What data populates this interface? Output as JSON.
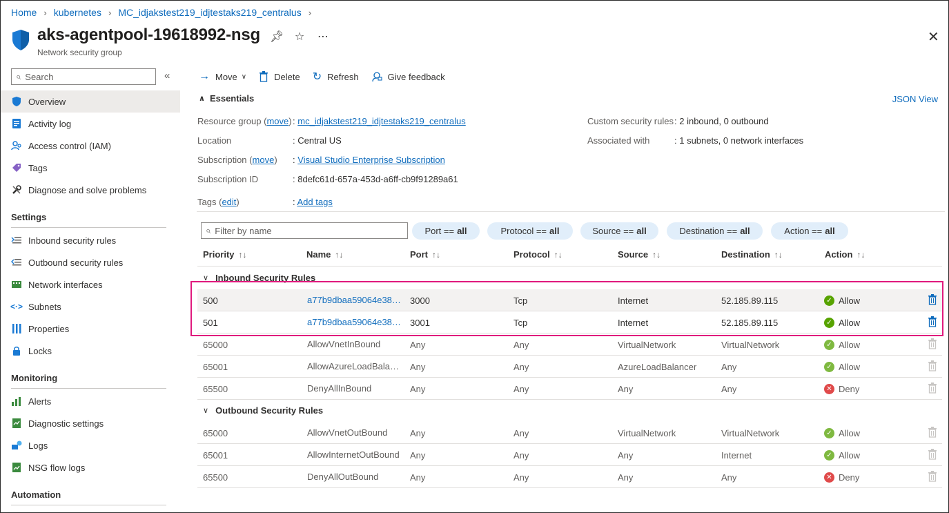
{
  "breadcrumb": [
    "Home",
    "kubernetes",
    "MC_idjakstest219_idjtestaks219_centralus"
  ],
  "header": {
    "title": "aks-agentpool-19618992-nsg",
    "subtitle": "Network security group"
  },
  "sidebar": {
    "search_placeholder": "Search",
    "items_top": [
      {
        "label": "Overview",
        "icon": "shield-icon",
        "selected": true
      },
      {
        "label": "Activity log",
        "icon": "activity-log-icon"
      },
      {
        "label": "Access control (IAM)",
        "icon": "people-icon"
      },
      {
        "label": "Tags",
        "icon": "tag-icon"
      },
      {
        "label": "Diagnose and solve problems",
        "icon": "wrench-icon"
      }
    ],
    "sections": [
      {
        "title": "Settings",
        "items": [
          {
            "label": "Inbound security rules",
            "icon": "inbound-rules-icon"
          },
          {
            "label": "Outbound security rules",
            "icon": "outbound-rules-icon"
          },
          {
            "label": "Network interfaces",
            "icon": "network-interface-icon"
          },
          {
            "label": "Subnets",
            "icon": "subnet-icon"
          },
          {
            "label": "Properties",
            "icon": "properties-icon"
          },
          {
            "label": "Locks",
            "icon": "lock-icon"
          }
        ]
      },
      {
        "title": "Monitoring",
        "items": [
          {
            "label": "Alerts",
            "icon": "alerts-icon"
          },
          {
            "label": "Diagnostic settings",
            "icon": "diagnostic-settings-icon"
          },
          {
            "label": "Logs",
            "icon": "logs-icon"
          },
          {
            "label": "NSG flow logs",
            "icon": "flow-logs-icon"
          }
        ]
      },
      {
        "title": "Automation",
        "items": []
      }
    ]
  },
  "toolbar": {
    "move": "Move",
    "delete": "Delete",
    "refresh": "Refresh",
    "feedback": "Give feedback"
  },
  "essentials": {
    "title": "Essentials",
    "json_view": "JSON View",
    "resource_group_label": "Resource group",
    "move_link": "move",
    "resource_group_value": "mc_idjakstest219_idjtestaks219_centralus",
    "location_label": "Location",
    "location_value": "Central US",
    "subscription_label": "Subscription",
    "subscription_value": "Visual Studio Enterprise Subscription",
    "subscription_id_label": "Subscription ID",
    "subscription_id_value": "8defc61d-657a-453d-a6ff-cb9f91289a61",
    "tags_label": "Tags",
    "edit_link": "edit",
    "tags_value": "Add tags",
    "custom_rules_label": "Custom security rules",
    "custom_rules_value": "2 inbound, 0 outbound",
    "associated_label": "Associated with",
    "associated_value": "1 subnets, 0 network interfaces"
  },
  "filters": {
    "placeholder": "Filter by name",
    "pills": [
      {
        "label": "Port ==",
        "value": "all"
      },
      {
        "label": "Protocol ==",
        "value": "all"
      },
      {
        "label": "Source ==",
        "value": "all"
      },
      {
        "label": "Destination ==",
        "value": "all"
      },
      {
        "label": "Action ==",
        "value": "all"
      }
    ]
  },
  "table": {
    "columns": [
      "Priority",
      "Name",
      "Port",
      "Protocol",
      "Source",
      "Destination",
      "Action"
    ],
    "groups": [
      {
        "title": "Inbound Security Rules",
        "rows": [
          {
            "priority": "500",
            "name": "a77b9dbaa59064e388…",
            "port": "3000",
            "protocol": "Tcp",
            "source": "Internet",
            "destination": "52.185.89.115",
            "action": "Allow",
            "custom": true
          },
          {
            "priority": "501",
            "name": "a77b9dbaa59064e388…",
            "port": "3001",
            "protocol": "Tcp",
            "source": "Internet",
            "destination": "52.185.89.115",
            "action": "Allow",
            "custom": true
          },
          {
            "priority": "65000",
            "name": "AllowVnetInBound",
            "port": "Any",
            "protocol": "Any",
            "source": "VirtualNetwork",
            "destination": "VirtualNetwork",
            "action": "Allow",
            "custom": false
          },
          {
            "priority": "65001",
            "name": "AllowAzureLoadBalanc…",
            "port": "Any",
            "protocol": "Any",
            "source": "AzureLoadBalancer",
            "destination": "Any",
            "action": "Allow",
            "custom": false
          },
          {
            "priority": "65500",
            "name": "DenyAllInBound",
            "port": "Any",
            "protocol": "Any",
            "source": "Any",
            "destination": "Any",
            "action": "Deny",
            "custom": false
          }
        ]
      },
      {
        "title": "Outbound Security Rules",
        "rows": [
          {
            "priority": "65000",
            "name": "AllowVnetOutBound",
            "port": "Any",
            "protocol": "Any",
            "source": "VirtualNetwork",
            "destination": "VirtualNetwork",
            "action": "Allow",
            "custom": false
          },
          {
            "priority": "65001",
            "name": "AllowInternetOutBound",
            "port": "Any",
            "protocol": "Any",
            "source": "Any",
            "destination": "Internet",
            "action": "Allow",
            "custom": false
          },
          {
            "priority": "65500",
            "name": "DenyAllOutBound",
            "port": "Any",
            "protocol": "Any",
            "source": "Any",
            "destination": "Any",
            "action": "Deny",
            "custom": false
          }
        ]
      }
    ]
  },
  "colors": {
    "link": "#0f6cbd",
    "allow": "#57a300",
    "deny": "#e00b1c",
    "highlight_border": "#e0197d",
    "selected_nav": "#edebe9"
  }
}
